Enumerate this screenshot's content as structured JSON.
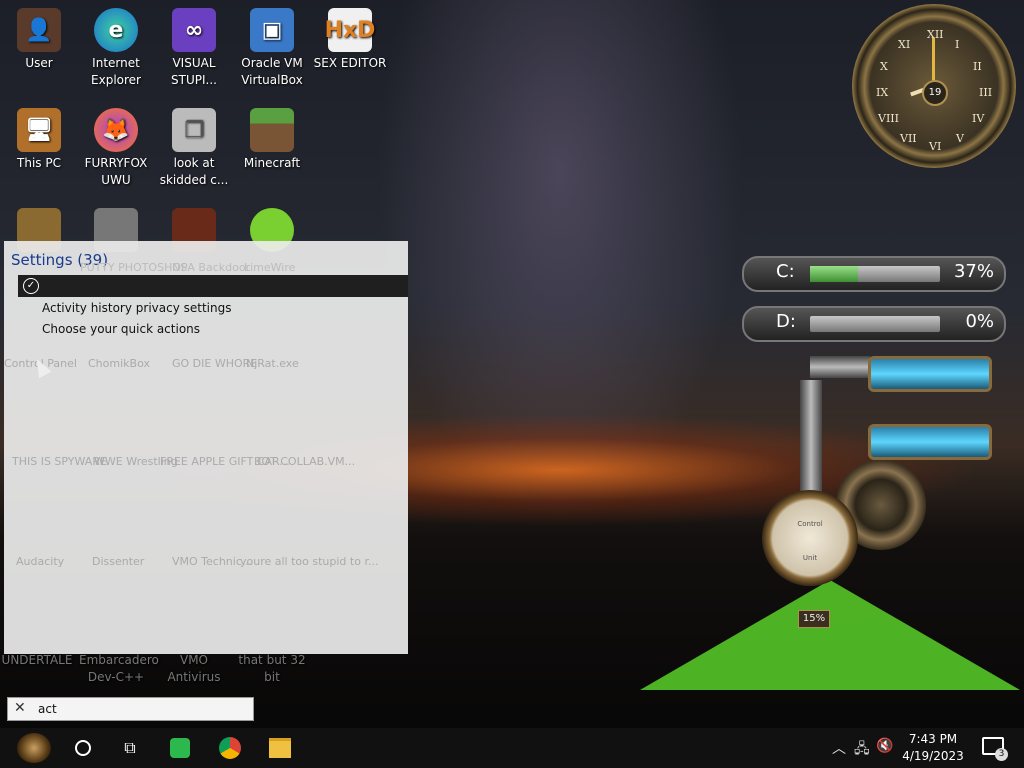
{
  "desktop_icons": [
    {
      "label": "User",
      "icon": "user-folder-icon"
    },
    {
      "label": "Internet Explorer",
      "icon": "edge-icon"
    },
    {
      "label": "VISUAL STUPI...",
      "icon": "visual-studio-icon"
    },
    {
      "label": "Oracle VM VirtualBox",
      "icon": "virtualbox-icon"
    },
    {
      "label": "SEX EDITOR",
      "icon": "hex-editor-icon"
    },
    {
      "label": "This PC",
      "icon": "this-pc-icon"
    },
    {
      "label": "FURRYFOX UWU",
      "icon": "firefox-icon"
    },
    {
      "label": "look at skidded c...",
      "icon": "files-icon"
    },
    {
      "label": "Minecraft",
      "icon": "minecraft-icon"
    }
  ],
  "ghost_icons": [
    {
      "label": "PUTTY PHOTOSHOP"
    },
    {
      "label": "NSA Backdoor"
    },
    {
      "label": "LimeWire"
    },
    {
      "label": "Control Panel"
    },
    {
      "label": "ChomikBox"
    },
    {
      "label": "GO DIE WHORE"
    },
    {
      "label": "NjRat.exe"
    },
    {
      "label": "THIS IS SPYWARE"
    },
    {
      "label": "WWE Wrestling"
    },
    {
      "label": "FREE APPLE GIFT CAR..."
    },
    {
      "label": "BOT COLLAB.VM..."
    },
    {
      "label": "Audacity"
    },
    {
      "label": "Dissenter"
    },
    {
      "label": "VMO Technic..."
    },
    {
      "label": "youre all too stupid to r..."
    },
    {
      "label": "UNDERTALE"
    },
    {
      "label": "Embarcadero Dev-C++"
    },
    {
      "label": "VMO Antivirus"
    },
    {
      "label": "that but 32 bit"
    }
  ],
  "clock": {
    "numerals": [
      "XII",
      "I",
      "II",
      "III",
      "IV",
      "V",
      "VI",
      "VII",
      "VIII",
      "IX",
      "X",
      "XI"
    ],
    "date": "19"
  },
  "drives": [
    {
      "letter": "C:",
      "percent_text": "37%",
      "percent": 37
    },
    {
      "letter": "D:",
      "percent_text": "0%",
      "percent": 0
    }
  ],
  "gauge": {
    "percent_text": "15%",
    "dial_text": "Control",
    "dial_sub": "Unit"
  },
  "search_results": {
    "header": "Settings (39)",
    "items": [
      "Activity history privacy settings",
      "Choose your quick actions"
    ]
  },
  "search": {
    "query": "act",
    "placeholder": ""
  },
  "taskbar": {
    "apps": [
      "gears-start-icon",
      "cortana-icon",
      "task-view-icon",
      "dissenter-icon",
      "chrome-icon",
      "file-explorer-icon"
    ],
    "time": "7:43 PM",
    "date": "4/19/2023",
    "notification_count": "3"
  }
}
